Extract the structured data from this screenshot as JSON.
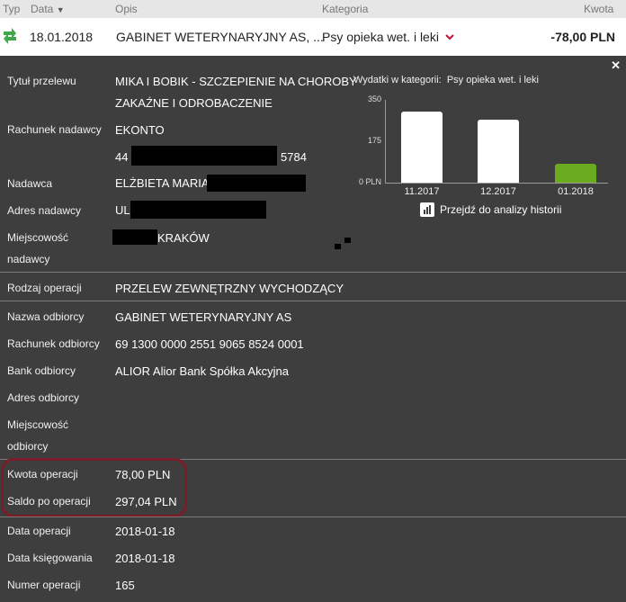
{
  "columns": {
    "typ": "Typ",
    "data": "Data",
    "opis": "Opis",
    "kategoria": "Kategoria",
    "kwota": "Kwota"
  },
  "transaction": {
    "date": "18.01.2018",
    "description": "GABINET WETERYNARYJNY AS, ...",
    "category": "Psy opieka wet. i leki",
    "amount": "-78,00 PLN"
  },
  "details": {
    "tytul_label": "Tytuł przelewu",
    "tytul_line1": "MIKA I BOBIK - SZCZEPIENIE NA CHOROBY",
    "tytul_line2": "ZAKAŹNE I ODROBACZENIE",
    "rach_nad_label": "Rachunek nadawcy",
    "rach_nad_name": "EKONTO",
    "rach_nad_prefix": "44",
    "rach_nad_suffix": "5784",
    "nadawca_label": "Nadawca",
    "nadawca_val": "ELŻBIETA MARIA",
    "adres_nad_label": "Adres nadawcy",
    "adres_nad_val": "UL",
    "miejsc_nad_label1": "Miejscowość",
    "miejsc_nad_label2": "nadawcy",
    "miejsc_nad_val": "KRAKÓW",
    "rodzaj_label": "Rodzaj operacji",
    "rodzaj_val": "PRZELEW ZEWNĘTRZNY WYCHODZĄCY",
    "nazwa_odb_label": "Nazwa odbiorcy",
    "nazwa_odb_val": "GABINET WETERYNARYJNY AS",
    "rach_odb_label": "Rachunek odbiorcy",
    "rach_odb_val": "69 1300 0000 2551 9065 8524 0001",
    "bank_odb_label": "Bank odbiorcy",
    "bank_odb_val": "ALIOR Alior Bank Spółka Akcyjna",
    "adres_odb_label": "Adres odbiorcy",
    "miejsc_odb_label1": "Miejscowość",
    "miejsc_odb_label2": "odbiorcy",
    "kwota_label": "Kwota operacji",
    "kwota_val": "78,00 PLN",
    "saldo_label": "Saldo po operacji",
    "saldo_val": "297,04 PLN",
    "data_op_label": "Data operacji",
    "data_op_val": "2018-01-18",
    "data_ks_label": "Data księgowania",
    "data_ks_val": "2018-01-18",
    "numer_label": "Numer operacji",
    "numer_val": "165"
  },
  "chart": {
    "title_prefix": "Wydatki w kategorii:",
    "title_category": "Psy opieka wet. i leki",
    "history_link": "Przejdź do analizy historii"
  },
  "chart_data": {
    "type": "bar",
    "categories": [
      "11.2017",
      "12.2017",
      "01.2018"
    ],
    "values": [
      300,
      265,
      78
    ],
    "ylim": [
      0,
      350
    ],
    "yticks": [
      "350",
      "175",
      "0 PLN"
    ],
    "colors": [
      "#ffffff",
      "#ffffff",
      "#6aaa1e"
    ]
  },
  "icons": {
    "close": "✕",
    "sort": "▼",
    "chevron": "⌄"
  }
}
